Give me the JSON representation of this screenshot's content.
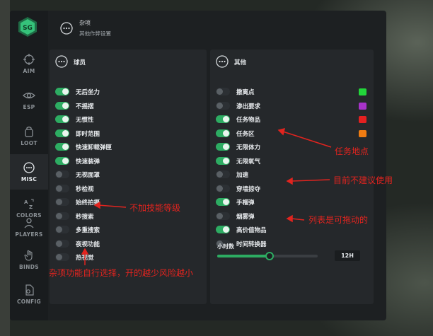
{
  "sidebar": {
    "items": [
      {
        "label": "AIM",
        "icon": "crosshair-icon"
      },
      {
        "label": "ESP",
        "icon": "eye-icon"
      },
      {
        "label": "LOOT",
        "icon": "bag-icon"
      },
      {
        "label": "MISC",
        "icon": "dots-circle-icon",
        "active": true
      },
      {
        "label": "COLORS",
        "icon": "translate-icon"
      },
      {
        "label": "PLAYERS",
        "icon": "users-icon"
      },
      {
        "label": "BINDS",
        "icon": "hand-icon"
      },
      {
        "label": "CONFIG",
        "icon": "gear-file-icon"
      }
    ]
  },
  "header": {
    "title": "杂项",
    "subtitle": "其他作弊设置"
  },
  "left_panel": {
    "title": "球员",
    "rows": [
      {
        "label": "无后坐力",
        "on": true
      },
      {
        "label": "不摇摆",
        "on": true
      },
      {
        "label": "无惯性",
        "on": true
      },
      {
        "label": "即时范围",
        "on": true
      },
      {
        "label": "快速卸载弹匣",
        "on": true
      },
      {
        "label": "快速装弹",
        "on": true
      },
      {
        "label": "无视面罩",
        "on": false
      },
      {
        "label": "秒检视",
        "on": false
      },
      {
        "label": "始终拍摄",
        "on": false
      },
      {
        "label": "秒搜索",
        "on": false
      },
      {
        "label": "多重搜索",
        "on": false
      },
      {
        "label": "夜视功能",
        "on": false
      },
      {
        "label": "热视觉",
        "on": false
      }
    ]
  },
  "right_panel": {
    "title": "其他",
    "rows": [
      {
        "label": "撤离点",
        "on": false,
        "color": "#22d63a"
      },
      {
        "label": "渗出要求",
        "on": false,
        "color": "#a733c9"
      },
      {
        "label": "任务物品",
        "on": true,
        "color": "#e42020"
      },
      {
        "label": "任务区",
        "on": true,
        "color": "#f07c12"
      },
      {
        "label": "无限体力",
        "on": true
      },
      {
        "label": "无限氧气",
        "on": true
      },
      {
        "label": "加速",
        "on": false
      },
      {
        "label": "穿墙掠夺",
        "on": false
      },
      {
        "label": "手榴弹",
        "on": true
      },
      {
        "label": "烟雾弹",
        "on": false
      },
      {
        "label": "高价值物品",
        "on": true
      },
      {
        "label": "时间转换器",
        "on": false
      }
    ],
    "slider": {
      "label": "小时数",
      "value_text": "12H",
      "fraction": 0.52
    }
  },
  "annotations": {
    "no_skill_level": "不加技能等级",
    "misc_note": "杂项功能自行选择，开的越少风险越小",
    "task_location": "任务地点",
    "not_recommended": "目前不建议使用",
    "draggable_list": "列表是可拖动的"
  },
  "colors": {
    "accent": "#2dac62",
    "annotation": "#e2241f"
  }
}
